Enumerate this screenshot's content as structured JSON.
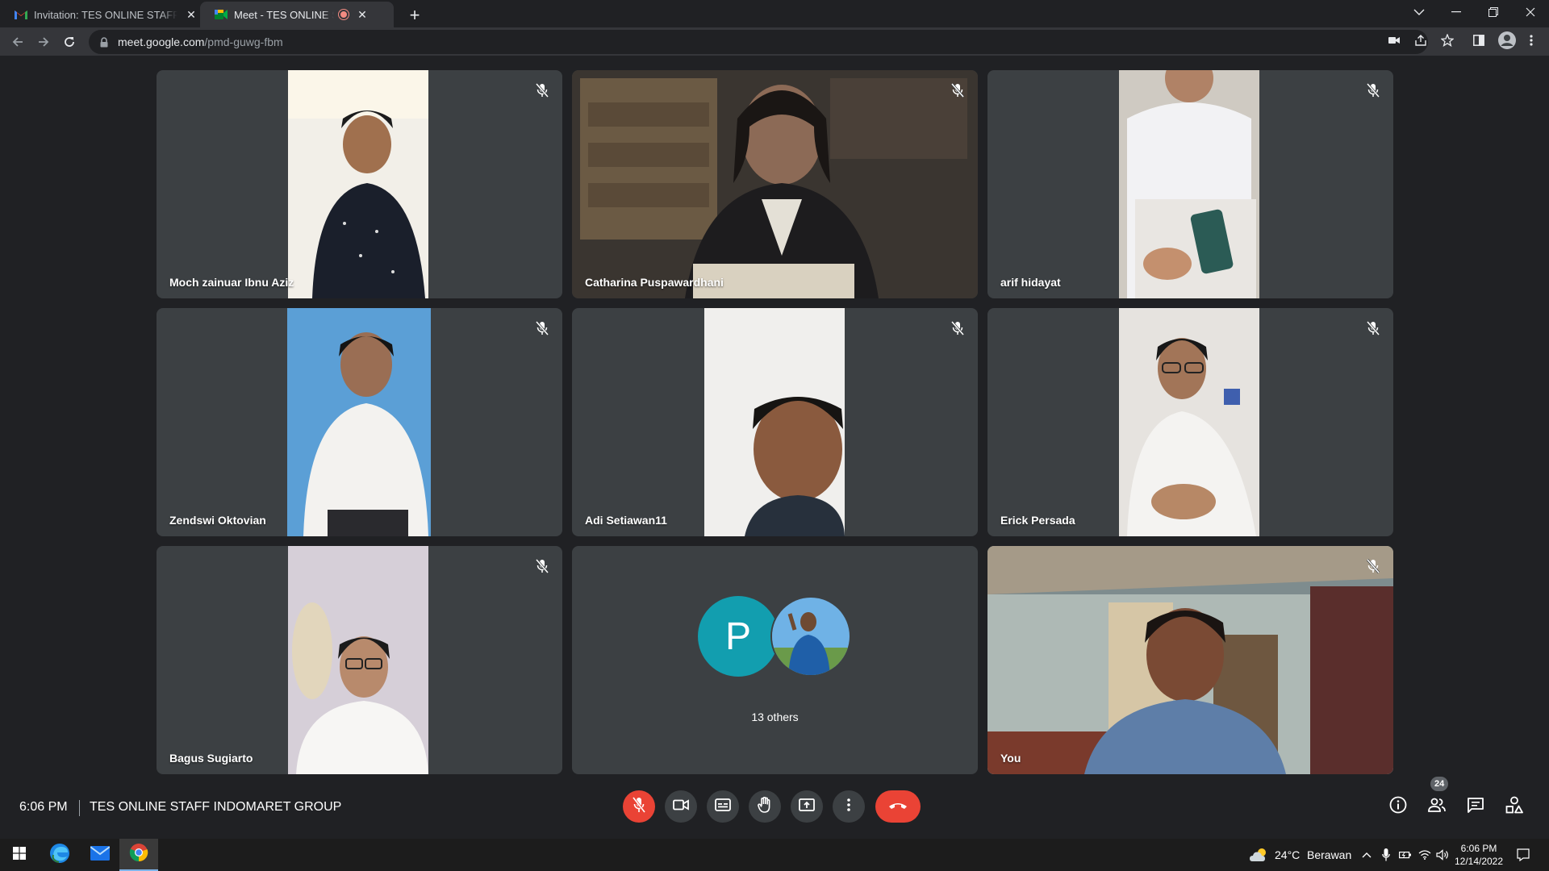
{
  "browser": {
    "tabs": [
      {
        "title": "Invitation: TES ONLINE STAFF INDOMARET GROUP",
        "favicon": "gmail-icon",
        "active": false
      },
      {
        "title": "Meet - TES ONLINE STAFF INDOMARET GROUP",
        "favicon": "google-meet-icon",
        "active": true,
        "recording": true
      }
    ],
    "url_host": "meet.google.com",
    "url_path": "/pmd-guwg-fbm"
  },
  "participants": [
    {
      "name": "Moch zainuar Ibnu Aziz",
      "muted": true
    },
    {
      "name": "Catharina Puspawardhani",
      "muted": true
    },
    {
      "name": "arif hidayat",
      "muted": true
    },
    {
      "name": "Zendswi Oktovian",
      "muted": true
    },
    {
      "name": "Adi Setiawan11",
      "muted": true
    },
    {
      "name": "Erick Persada",
      "muted": true
    },
    {
      "name": "Bagus Sugiarto",
      "muted": true
    },
    {
      "name": "You",
      "muted": true
    }
  ],
  "others": {
    "label": "13 others",
    "avatar_letter": "P",
    "avatar_color": "#129eaf"
  },
  "meeting": {
    "time": "6:06 PM",
    "title": "TES ONLINE STAFF INDOMARET GROUP",
    "participant_count": "24"
  },
  "taskbar": {
    "temperature": "24°C",
    "weather": "Berawan",
    "time": "6:06 PM",
    "date": "12/14/2022"
  },
  "colors": {
    "end_call": "#ea4335",
    "tile_bg": "#3c4043",
    "page_bg": "#202124"
  }
}
